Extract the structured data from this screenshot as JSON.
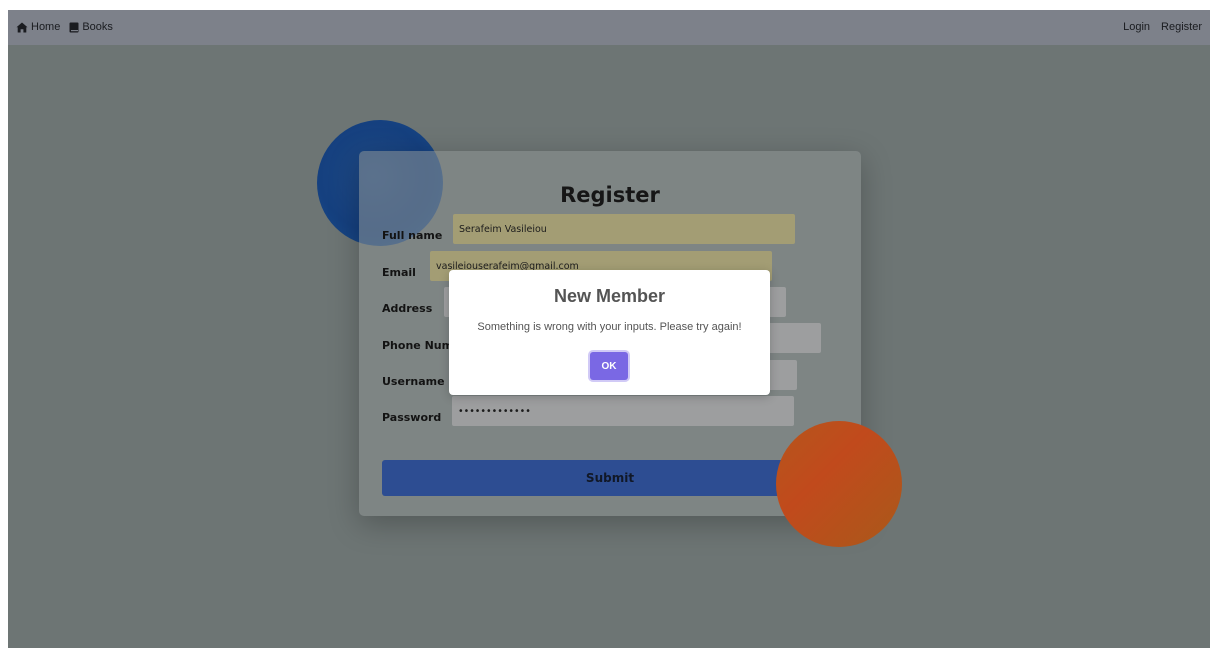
{
  "nav": {
    "home_label": "Home",
    "books_label": "Books",
    "login_label": "Login",
    "register_label": "Register"
  },
  "form": {
    "title": "Register",
    "fields": [
      {
        "label": "Full name",
        "value": "Serafeim Vasileiou"
      },
      {
        "label": "Email",
        "value": "vasileiouserafeim@gmail.com"
      },
      {
        "label": "Address",
        "value": ""
      },
      {
        "label": "Phone Number",
        "value": ""
      },
      {
        "label": "Username",
        "value": ""
      },
      {
        "label": "Password",
        "value": "•••••••••••••"
      }
    ],
    "submit_label": "Submit"
  },
  "dialog": {
    "title": "New Member",
    "message": "Something is wrong with your inputs. Please try again!",
    "ok_label": "OK"
  },
  "colors": {
    "overlay_background": "#6d7574",
    "navbar": "#7d818a",
    "submit_button": "#2d4d92",
    "ok_button": "#7a68e4",
    "autofill_input": "#a39d74"
  },
  "icons": {
    "home": "home-icon",
    "books": "book-icon"
  }
}
